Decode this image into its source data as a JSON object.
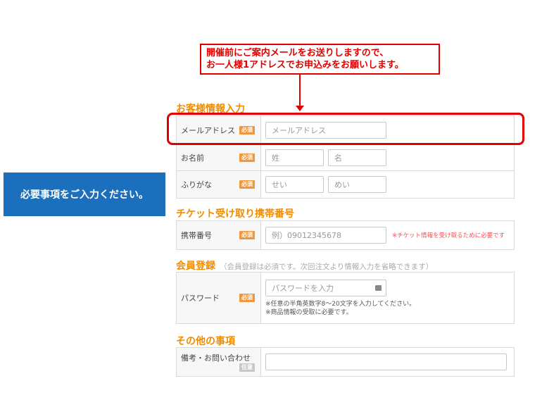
{
  "callout": {
    "line1": "開催前にご案内メールをお送りしますので、",
    "line2": "お一人様1アドレスでお申込みをお願いします。"
  },
  "banner": {
    "text": "必要事項をご入力ください。"
  },
  "badges": {
    "required": "必須",
    "optional": "任意"
  },
  "customer_section": {
    "title": "お客様情報入力",
    "email": {
      "label": "メールアドレス",
      "placeholder": "メールアドレス"
    },
    "name": {
      "label": "お名前",
      "last_placeholder": "姓",
      "first_placeholder": "名"
    },
    "kana": {
      "label": "ふりがな",
      "last_placeholder": "せい",
      "first_placeholder": "めい"
    }
  },
  "ticket_section": {
    "title": "チケット受け取り携帯番号",
    "phone": {
      "label": "携帯番号",
      "placeholder": "例）09012345678",
      "hint": "※チケット情報を受け取るために必要です"
    }
  },
  "member_section": {
    "title": "会員登録",
    "note": "（会員登録は必須です。次回注文より情報入力を省略できます）",
    "password": {
      "label": "パスワード",
      "placeholder": "パスワードを入力",
      "note1": "※任意の半角英数字8～20文字を入力してください。",
      "note2": "※商品情報の受取に必要です。"
    }
  },
  "other_section": {
    "title": "その他の事項",
    "remarks": {
      "label": "備考・お問い合わせ",
      "value": ""
    }
  },
  "colors": {
    "accent": "#f08c00",
    "highlight_red": "#e00000",
    "banner_blue": "#1b6fbd",
    "required_badge": "#f0963c"
  }
}
